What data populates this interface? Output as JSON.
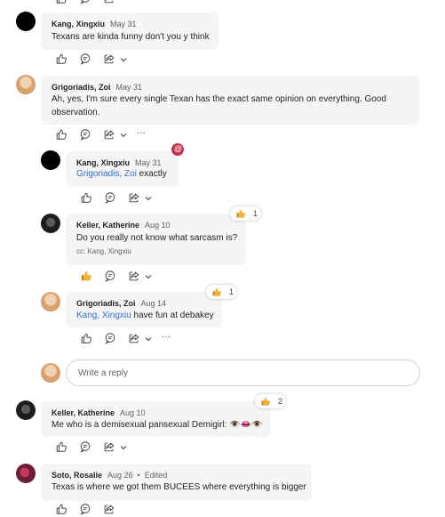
{
  "comments": [
    {
      "author": "Kang, Xingxiu",
      "date": "May 31",
      "text": "Texans are kinda funny don't you y think",
      "avatar": "black-avatar"
    },
    {
      "author": "Grigoriadis, Zoi",
      "date": "May 31",
      "text_line1": "Ah, yes, I'm sure every single Texan has the exact same opinion on everything. Good",
      "text_line2": "observation.",
      "avatar": "zoi-photo",
      "more": "···",
      "replies": [
        {
          "author": "Kang, Xingxiu",
          "date": "May 31",
          "mention": "Grigoriadis, Zoi",
          "text": " exactly",
          "mention_badge": "@"
        },
        {
          "author": "Keller, Katherine",
          "date": "Aug 10",
          "text": "Do you really not know what sarcasm is?",
          "cc": "cc: Kang, Xingxiu",
          "reaction_icon": "thumbs-up",
          "reaction_count": "1"
        },
        {
          "author": "Grigoriadis, Zoi",
          "date": "Aug 14",
          "mention": "Kang, Xingxiu",
          "text": " have fun at debakey",
          "reaction_icon": "thumbs-up",
          "reaction_count": "1",
          "more": "···"
        }
      ],
      "reply_placeholder": "Write a reply"
    },
    {
      "author": "Keller, Katherine",
      "date": "Aug 10",
      "text": "Me who is a demisexual pansexual Demigirl: 👁️👄👁️",
      "reaction_icon": "thumbs-up",
      "reaction_count": "2"
    },
    {
      "author": "Soto, Rosalie",
      "date": "Aug 26",
      "separator": "•",
      "edited": "Edited",
      "text": "Texas is where we got them BUCEES where everything is bigger"
    }
  ],
  "colors": {
    "accent": "#2f6fcf",
    "mention_badge": "#c4314b",
    "bubble": "#f5f5f5",
    "like": "#e8a317"
  },
  "icons": [
    "like-icon",
    "comment-icon",
    "share-icon",
    "chevron-down-icon",
    "more-icon",
    "thumbs-up-icon",
    "at-mention-icon"
  ]
}
